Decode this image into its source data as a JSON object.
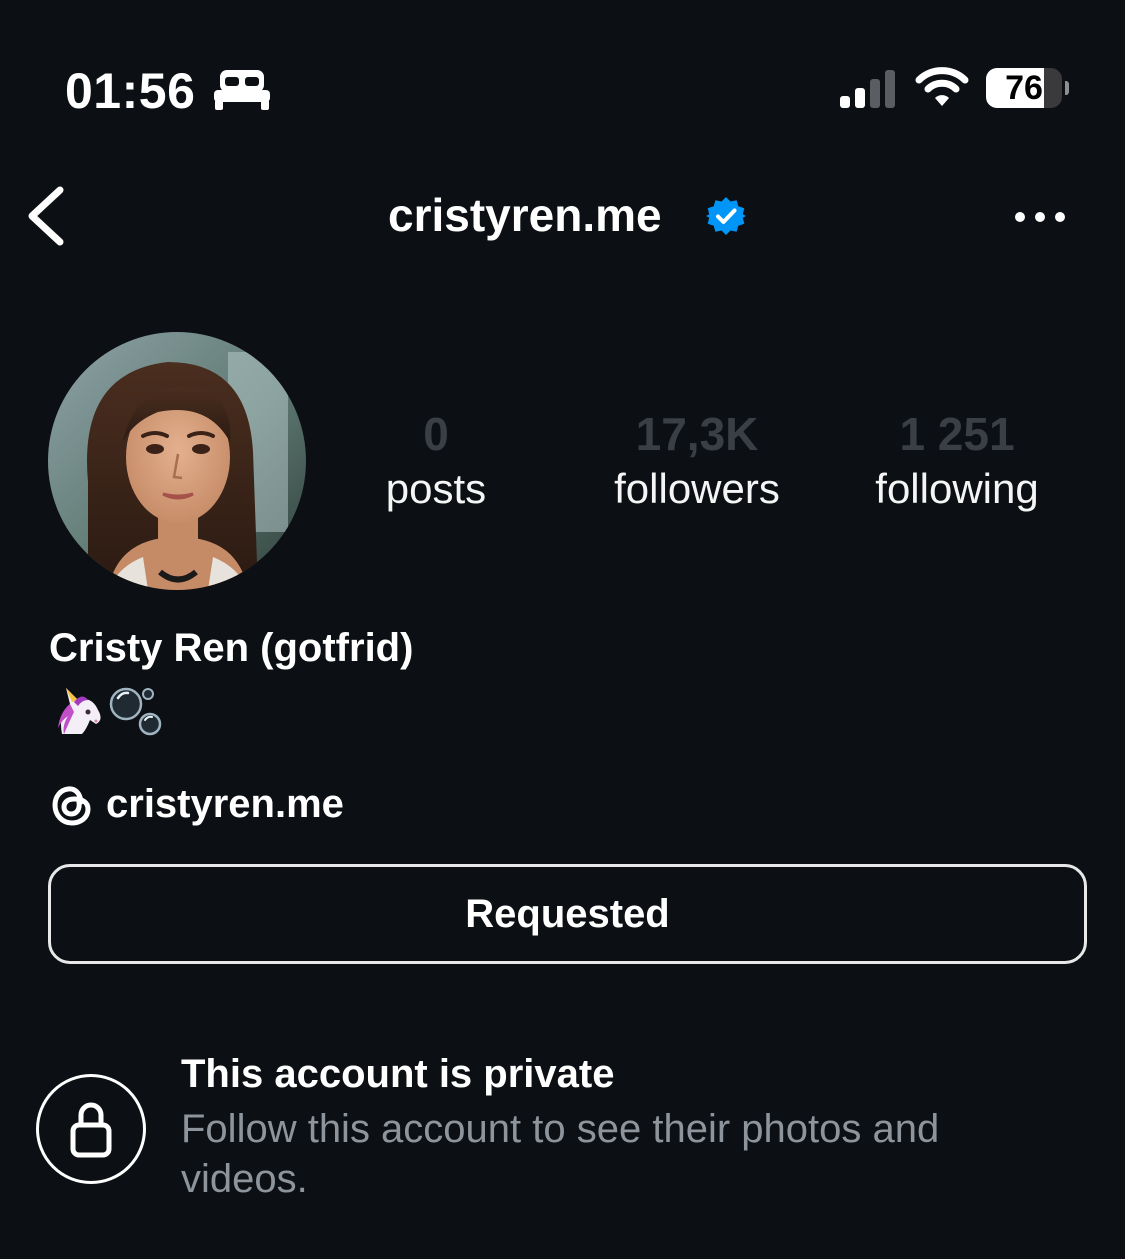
{
  "status_bar": {
    "time": "01:56",
    "focus_icon": "bed-icon",
    "battery_percent": 76
  },
  "header": {
    "username": "cristyren.me",
    "verified": true,
    "back_icon": "chevron-left-icon",
    "more_icon": "ellipsis-icon"
  },
  "profile": {
    "avatar_icon": "profile-photo",
    "stats": [
      {
        "value": "0",
        "label": "posts"
      },
      {
        "value": "17,3K",
        "label": "followers"
      },
      {
        "value": "1 251",
        "label": "following"
      }
    ],
    "full_name": "Cristy Ren (gotfrid)",
    "bio_emojis": "🦄🫧",
    "threads_handle": "cristyren.me"
  },
  "actions": {
    "follow_button_label": "Requested"
  },
  "private_notice": {
    "title": "This account is private",
    "description": "Follow this account to see their photos and videos."
  },
  "colors": {
    "background": "#0c1014",
    "verified_blue": "#0095f6",
    "muted_text": "#8e949b",
    "stat_value": "#3a3f45"
  }
}
